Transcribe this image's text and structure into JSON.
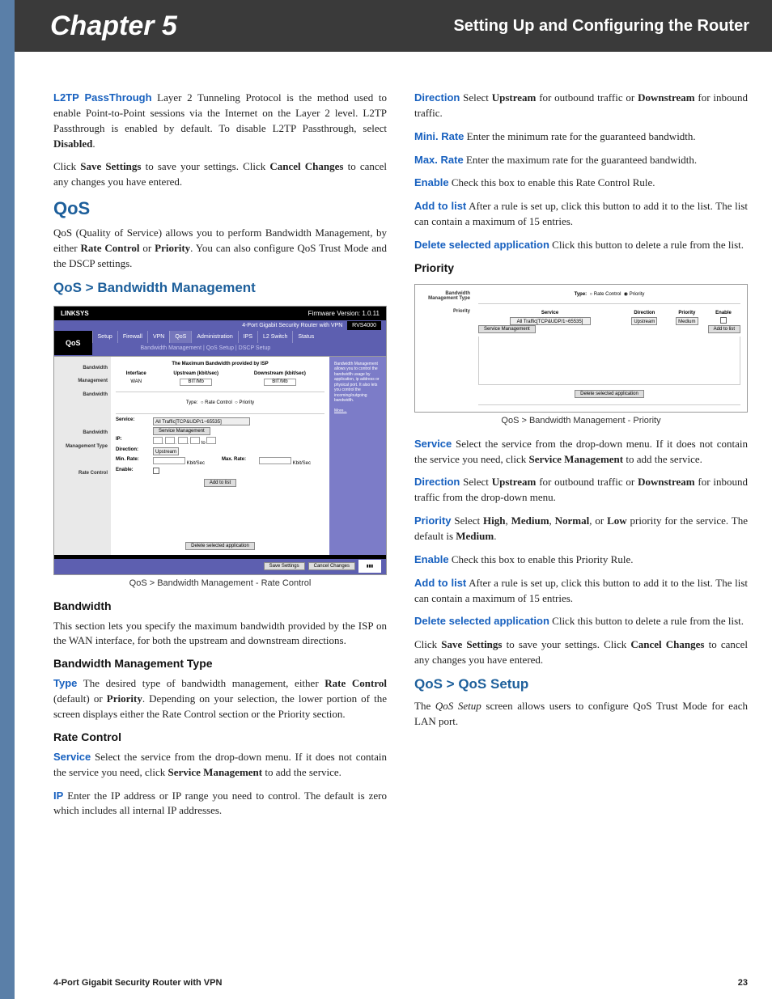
{
  "header": {
    "chapter": "Chapter 5",
    "section": "Setting Up and Configuring the Router"
  },
  "col1": {
    "p1_term": "L2TP PassThrough",
    "p1_rest": " Layer 2 Tunneling Protocol is the method used to enable Point-to-Point sessions via the Internet on the Layer 2 level. L2TP Passthrough is enabled by default. To disable L2TP Passthrough, select ",
    "p1_bold": "Disabled",
    "p1_end": ".",
    "p2_a": "Click ",
    "p2_b": "Save Settings",
    "p2_c": " to save your settings. Click ",
    "p2_d": "Cancel Changes",
    "p2_e": " to cancel any changes you have entered.",
    "h_qos": "QoS",
    "p3_a": "QoS (Quality of Service) allows you to perform Bandwidth Management, by either ",
    "p3_b": "Rate Control",
    "p3_c": " or ",
    "p3_d": "Priority",
    "p3_e": ". You can also configure QoS Trust Mode and the DSCP settings.",
    "h_bw": "QoS > Bandwidth Management",
    "fig1_caption": "QoS > Bandwidth Management - Rate Control",
    "h_bandwidth": "Bandwidth",
    "p4": "This section lets you specify the maximum bandwidth provided by the ISP on the WAN interface, for both the upstream and downstream directions.",
    "h_bmtype": "Bandwidth Management Type",
    "p5_term": "Type",
    "p5_a": "  The desired type of bandwidth management, either ",
    "p5_b": "Rate Control",
    "p5_c": " (default) or ",
    "p5_d": "Priority",
    "p5_e": ". Depending on your selection, the lower portion of the screen displays either the Rate Control section or the Priority section.",
    "h_ratecontrol": "Rate Control",
    "p6_term": "Service",
    "p6_a": "  Select the service from the drop-down menu. If it does not contain the service you need, click ",
    "p6_b": "Service Management",
    "p6_c": " to add the service.",
    "p7_term": "IP",
    "p7_a": "  Enter the IP address or IP range you need to control. The default is zero which includes all internal IP addresses."
  },
  "col2": {
    "p1_term": "Direction",
    "p1_a": " Select ",
    "p1_b": "Upstream",
    "p1_c": " for outbound traffic or ",
    "p1_d": "Downstream",
    "p1_e": " for inbound traffic.",
    "p2_term": "Mini. Rate",
    "p2_a": "  Enter the minimum rate for the guaranteed bandwidth.",
    "p3_term": "Max. Rate",
    "p3_a": "  Enter the maximum rate for the guaranteed bandwidth.",
    "p4_term": "Enable",
    "p4_a": "  Check this box to enable this Rate Control Rule.",
    "p5_term": "Add to list",
    "p5_a": "  After a rule is set up, click this button to add it to the list. The list can contain a maximum of 15 entries.",
    "p6_term": "Delete selected application",
    "p6_a": "  Click this button to delete a rule from the list.",
    "h_priority": "Priority",
    "fig2_caption": "QoS > Bandwidth Management - Priority",
    "p7_term": "Service",
    "p7_a": "  Select the service from the drop-down menu. If it does not contain the service you need, click ",
    "p7_b": "Service Management",
    "p7_c": " to add the service.",
    "p8_term": "Direction",
    "p8_a": " Select ",
    "p8_b": "Upstream",
    "p8_c": " for outbound traffic or ",
    "p8_d": "Downstream",
    "p8_e": " for inbound traffic from the drop-down menu.",
    "p9_term": "Priority",
    "p9_a": "  Select ",
    "p9_b": "High",
    "p9_c": ", ",
    "p9_d": "Medium",
    "p9_e": ", ",
    "p9_f": "Normal",
    "p9_g": ", or ",
    "p9_h": "Low",
    "p9_i": " priority for the service. The default is ",
    "p9_j": "Medium",
    "p9_k": ".",
    "p10_term": "Enable",
    "p10_a": "  Check this box to enable this Priority Rule.",
    "p11_term": "Add to list",
    "p11_a": "  After a rule is set up, click this button to add it to the list. The list can contain a maximum of 15 entries.",
    "p12_term": "Delete selected application",
    "p12_a": "  Click this button to delete a rule from the list.",
    "p13_a": "Click ",
    "p13_b": "Save Settings",
    "p13_c": " to save your settings. Click ",
    "p13_d": "Cancel Changes",
    "p13_e": " to cancel any changes you have entered.",
    "h_qossetup": "QoS > QoS Setup",
    "p14_a": "The ",
    "p14_b": "QoS Setup",
    "p14_c": " screen allows users to configure QoS Trust Mode for each LAN port."
  },
  "fig1": {
    "brand": "LINKSYS",
    "fw": "Firmware Version: 1.0.11",
    "product": "4-Port Gigabit Security Router with VPN",
    "model": "RVS4000",
    "tab_label": "QoS",
    "tabs": [
      "Setup",
      "Firewall",
      "VPN",
      "QoS",
      "Administration",
      "IPS",
      "L2 Switch",
      "Status"
    ],
    "subtabs": "Bandwidth Management   |   QoS Setup   |   DSCP Setup",
    "side_items": [
      "Bandwidth Management",
      "Bandwidth",
      "Bandwidth Management Type",
      "Rate Control"
    ],
    "bw_heading": "The Maximum Bandwidth provided by ISP",
    "bw_cols": [
      "Interface",
      "Upstream (kbit/sec)",
      "Downstream (kbit/sec)"
    ],
    "bw_row": [
      "WAN",
      "BIT/Mb",
      "BIT/Mb"
    ],
    "type_label": "Type:",
    "rc_label": "Rate Control",
    "pr_label": "Priority",
    "svc_label": "Service:",
    "svc_value": "All Traffic[TCP&UDP/1~65535]",
    "svc_mgmt": "Service Management",
    "ip_label": "IP:",
    "dir_label": "Direction:",
    "dir_value": "Upstream",
    "min_label": "Min. Rate:",
    "max_label": "Max. Rate:",
    "kbps": "Kbit/Sec",
    "enable_label": "Enable:",
    "add_list": "Add to list",
    "del_app": "Delete selected application",
    "help_text": "Bandwidth Management allows you to control the bandwidth usage by application, ip address or physical port. It also lets you control the incoming/outgoing bandwidth.",
    "more": "More...",
    "save": "Save Settings",
    "cancel": "Cancel Changes"
  },
  "fig2": {
    "side1": "Bandwidth Management Type",
    "side2": "Priority",
    "type_label": "Type:",
    "rc_label": "Rate Control",
    "pr_label": "Priority",
    "cols": [
      "Service",
      "Direction",
      "Priority",
      "Enable"
    ],
    "svc_value": "All Traffic[TCP&UDP/1~65535]",
    "dir_value": "Upstream",
    "pri_value": "Medium",
    "svc_mgmt": "Service Management",
    "add_list": "Add to list",
    "del_app": "Delete selected application"
  },
  "footer": {
    "left": "4-Port Gigabit Security Router with VPN",
    "right": "23"
  }
}
